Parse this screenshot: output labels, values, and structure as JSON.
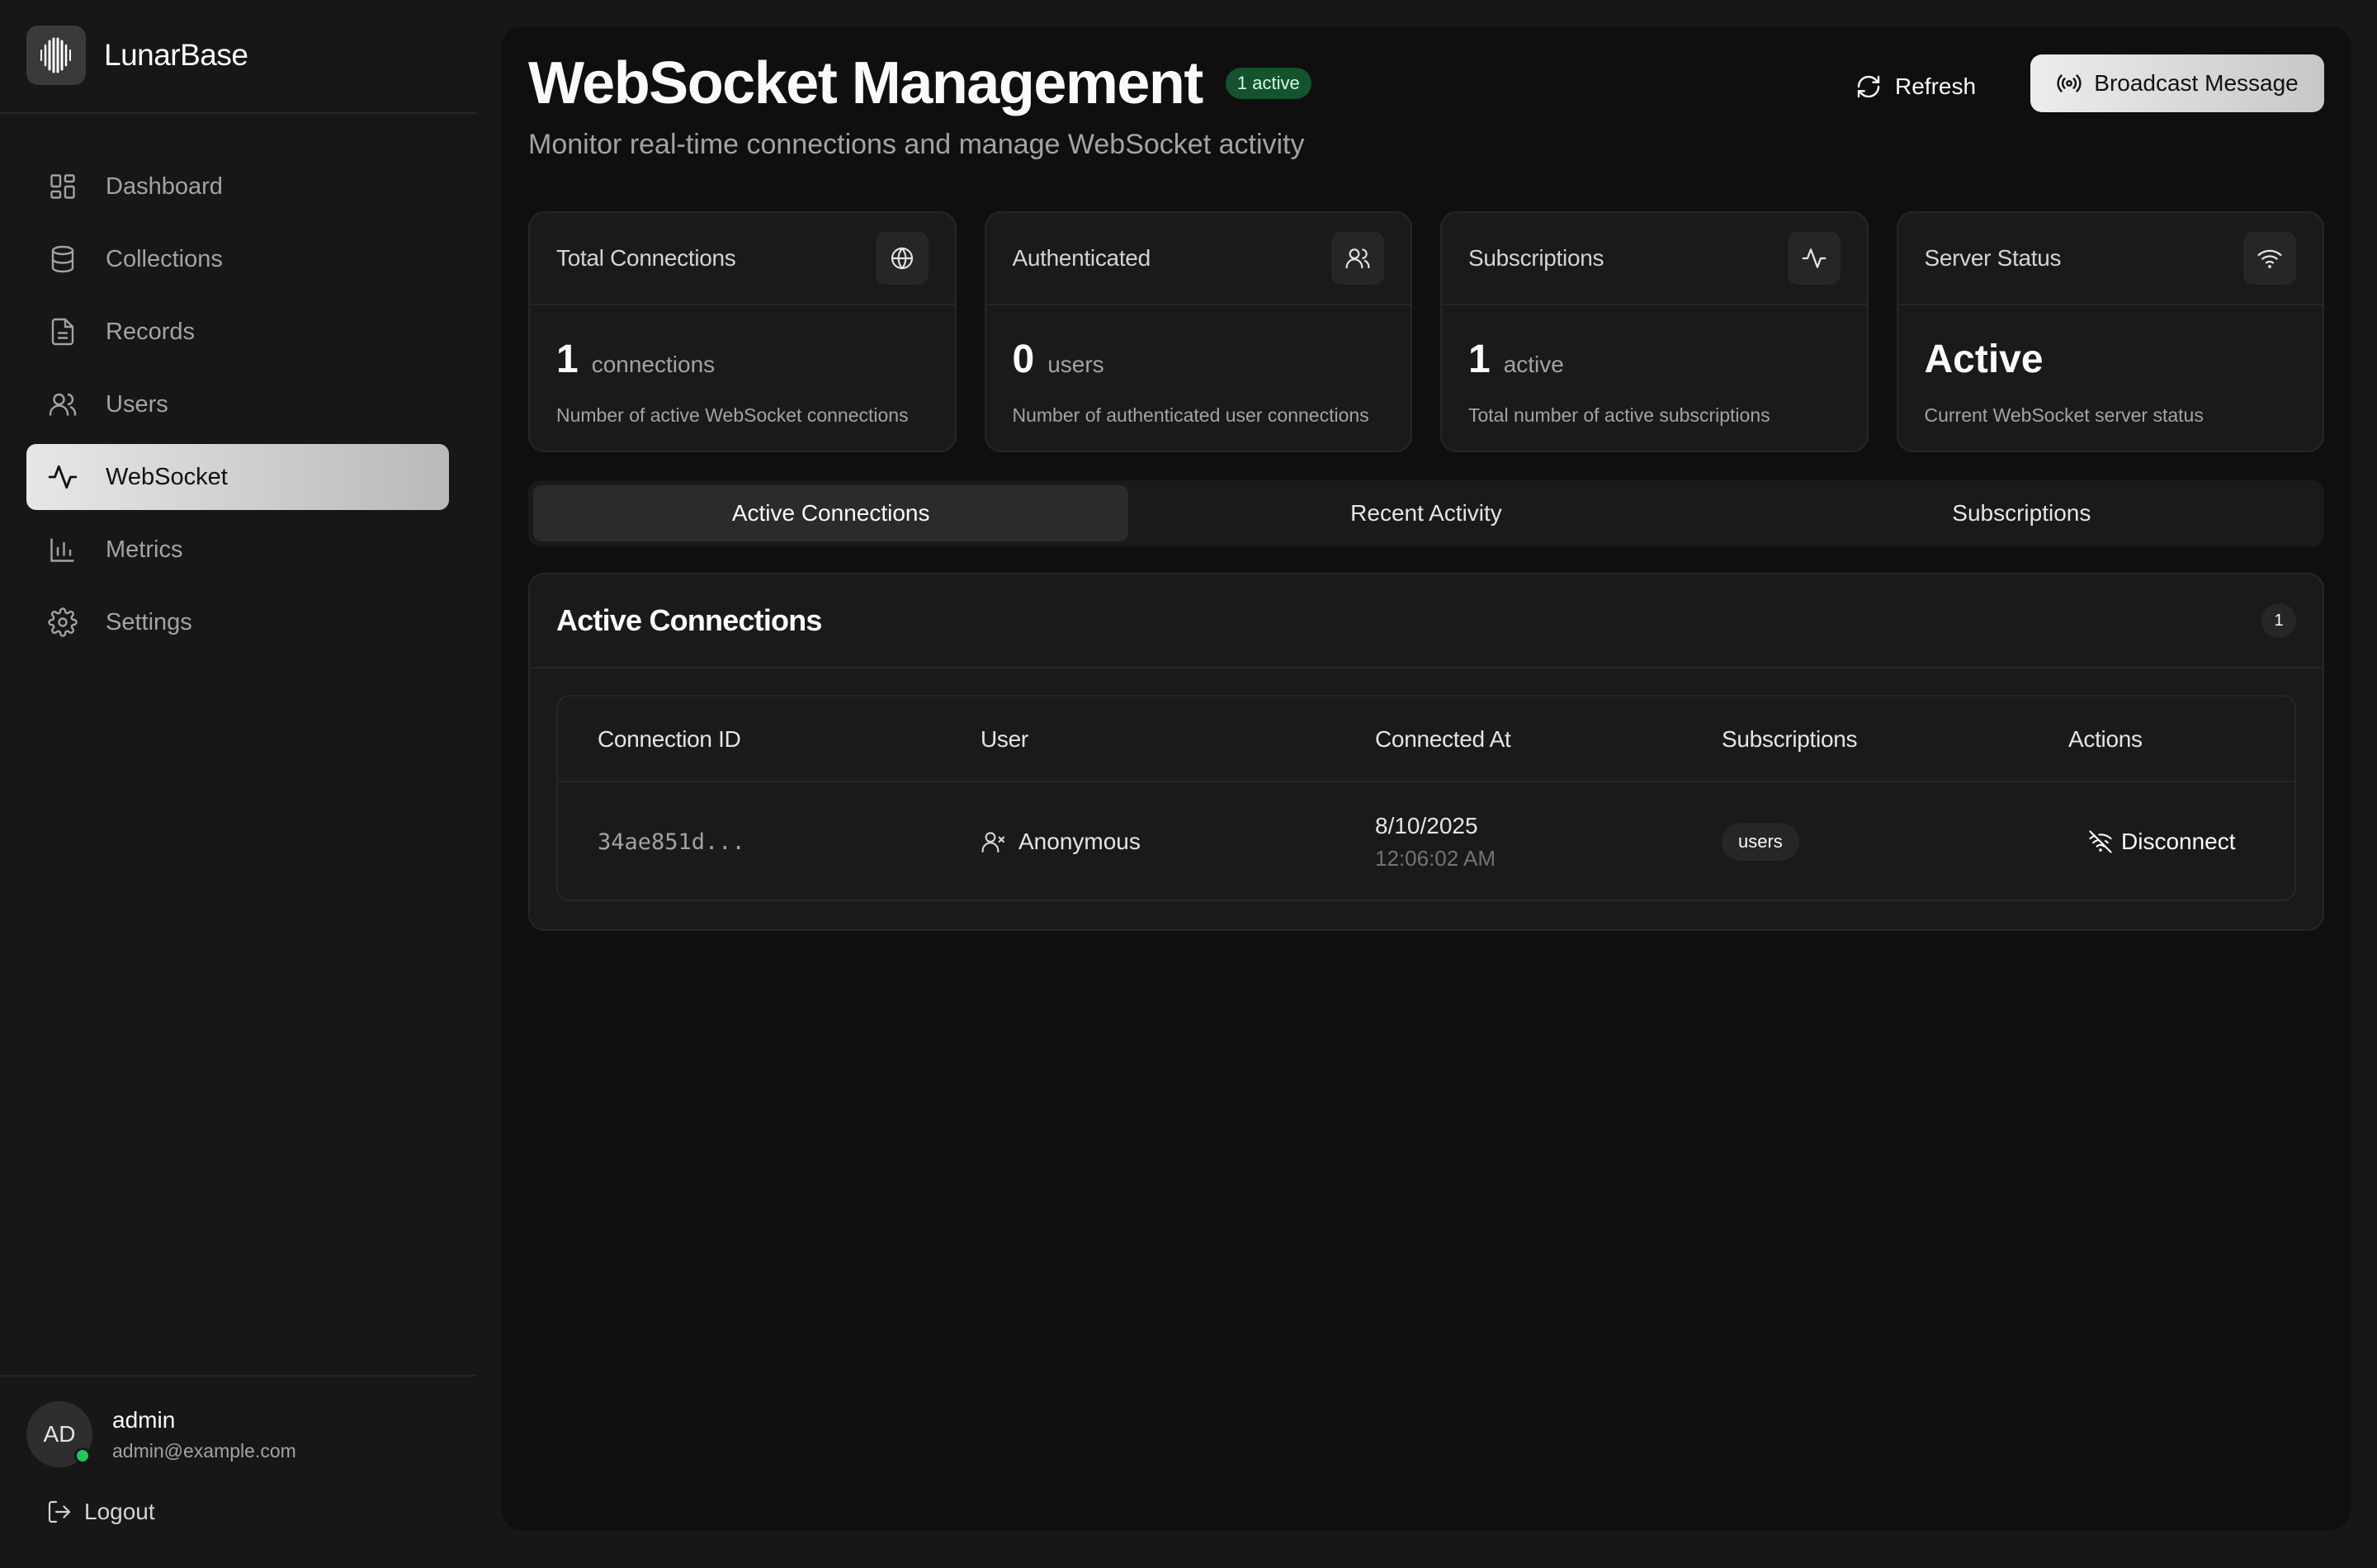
{
  "brand": {
    "name": "LunarBase"
  },
  "sidebar": {
    "items": [
      {
        "label": "Dashboard",
        "icon": "dashboard-icon"
      },
      {
        "label": "Collections",
        "icon": "database-icon"
      },
      {
        "label": "Records",
        "icon": "file-icon"
      },
      {
        "label": "Users",
        "icon": "users-icon"
      },
      {
        "label": "WebSocket",
        "icon": "activity-icon",
        "active": true
      },
      {
        "label": "Metrics",
        "icon": "bar-chart-icon"
      },
      {
        "label": "Settings",
        "icon": "gear-icon"
      }
    ]
  },
  "user": {
    "initials": "AD",
    "name": "admin",
    "email": "admin@example.com",
    "status_color": "#22c55e"
  },
  "logout": {
    "label": "Logout"
  },
  "header": {
    "title": "WebSocket Management",
    "badge": "1 active",
    "subtitle": "Monitor real-time connections and manage WebSocket activity",
    "refresh_label": "Refresh",
    "broadcast_label": "Broadcast Message"
  },
  "cards": [
    {
      "title": "Total Connections",
      "value": "1",
      "unit": "connections",
      "desc": "Number of active WebSocket connections",
      "icon": "globe-icon"
    },
    {
      "title": "Authenticated",
      "value": "0",
      "unit": "users",
      "desc": "Number of authenticated user connections",
      "icon": "users-icon"
    },
    {
      "title": "Subscriptions",
      "value": "1",
      "unit": "active",
      "desc": "Total number of active subscriptions",
      "icon": "activity-icon"
    },
    {
      "title": "Server Status",
      "value": "Active",
      "unit": "",
      "desc": "Current WebSocket server status",
      "icon": "wifi-icon"
    }
  ],
  "tabs": [
    {
      "label": "Active Connections",
      "active": true
    },
    {
      "label": "Recent Activity"
    },
    {
      "label": "Subscriptions"
    }
  ],
  "connections": {
    "title": "Active Connections",
    "count": "1",
    "columns": [
      "Connection ID",
      "User",
      "Connected At",
      "Subscriptions",
      "Actions"
    ],
    "rows": [
      {
        "id": "34ae851d...",
        "user": "Anonymous",
        "date": "8/10/2025",
        "time": "12:06:02 AM",
        "subscription": "users",
        "action": "Disconnect"
      }
    ]
  },
  "colors": {
    "accent_green": "#14532d",
    "online": "#22c55e"
  }
}
